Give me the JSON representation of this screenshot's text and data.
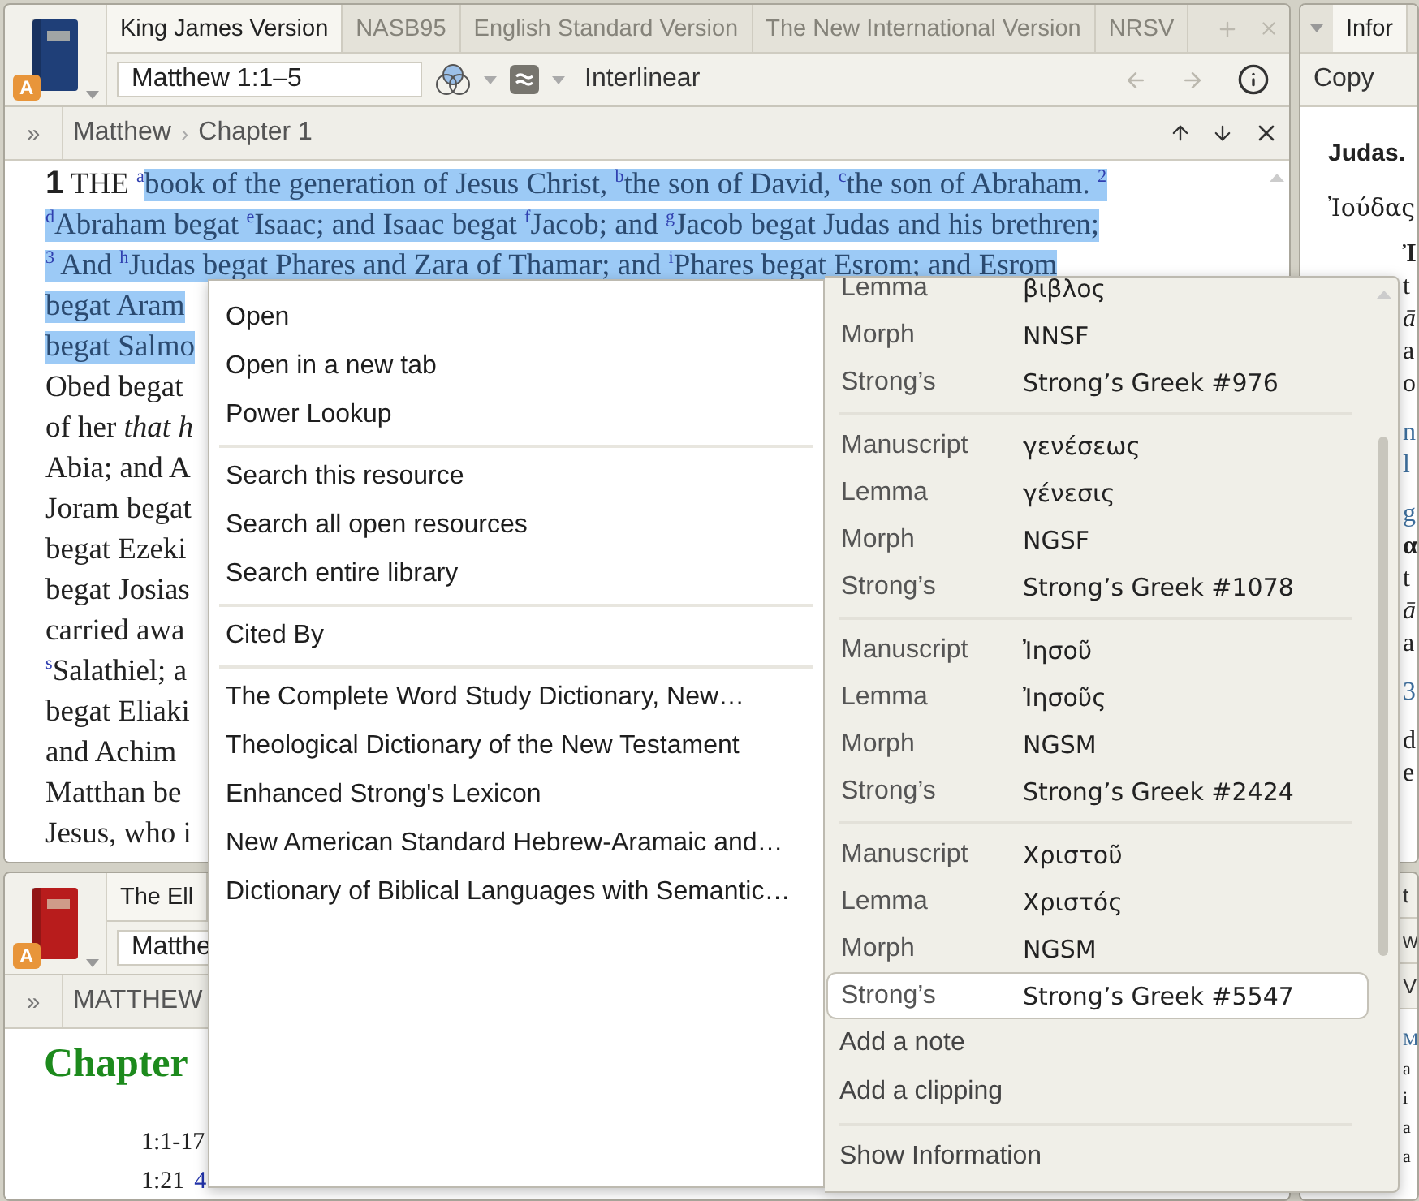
{
  "main_panel": {
    "badge": "A",
    "tabs": [
      {
        "label": "King James Version",
        "selected": true
      },
      {
        "label": "NASB95",
        "selected": false
      },
      {
        "label": "English Standard Version",
        "selected": false
      },
      {
        "label": "The New International Version",
        "selected": false
      },
      {
        "label": "NRSV",
        "selected": false
      }
    ],
    "reference": "Matthew 1:1–5",
    "view_label": "Interlinear",
    "back": {
      "disabled": true
    },
    "forward": {
      "disabled": true
    },
    "nav": {
      "expand": "»",
      "crumbs": [
        "Matthew",
        "Chapter 1"
      ],
      "separator": "›"
    },
    "lines": [
      {
        "segments": [
          {
            "text": "**1** THE $^{a}$",
            "selected": false
          },
          {
            "text": "book of the generation of Jesus Christ, $^{b}$the son of David, $^{c}$the son of Abraham. $^{2}$",
            "selected": true
          }
        ]
      },
      {
        "segments": [
          {
            "text": "$^{d}$Abraham begat $^{e}$Isaac; and Isaac begat $^{f}$Jacob; and $^{g}$Jacob begat Judas and his brethren;",
            "selected": true
          }
        ]
      },
      {
        "segments": [
          {
            "text": "$^{3}$ And $^{h}$Judas begat Phares and Zara of Thamar; and $^{i}$Phares begat Esrom; and Esrom",
            "selected": true
          }
        ]
      },
      {
        "segments": [
          {
            "text": "begat Aram",
            "selected": true
          }
        ]
      },
      {
        "segments": [
          {
            "text": "begat Salmo",
            "selected": true
          }
        ]
      },
      {
        "segments": [
          {
            "text": "Obed begat",
            "selected": false
          }
        ]
      },
      {
        "segments": [
          {
            "text": "of her *that h*",
            "selected": false
          }
        ]
      },
      {
        "segments": [
          {
            "text": "Abia; and A",
            "selected": false
          }
        ]
      },
      {
        "segments": [
          {
            "text": "Joram begat",
            "selected": false
          }
        ]
      },
      {
        "segments": [
          {
            "text": "begat Ezeki",
            "selected": false
          }
        ]
      },
      {
        "segments": [
          {
            "text": "begat Josias",
            "selected": false
          }
        ]
      },
      {
        "segments": [
          {
            "text": "carried awa",
            "selected": false
          }
        ]
      },
      {
        "segments": [
          {
            "text": "$^{s}$Salathiel; a",
            "selected": false
          }
        ]
      },
      {
        "segments": [
          {
            "text": "begat Eliaki",
            "selected": false
          }
        ]
      },
      {
        "segments": [
          {
            "text": "and Achim",
            "selected": false
          }
        ]
      },
      {
        "segments": [
          {
            "text": "Matthan be",
            "selected": false
          }
        ]
      },
      {
        "segments": [
          {
            "text": "Jesus, who i",
            "selected": false
          }
        ]
      }
    ]
  },
  "context_menu": {
    "groups": [
      [
        "Open",
        "Open in a new tab",
        "Power Lookup"
      ],
      [
        "Search this resource",
        "Search all open resources",
        "Search entire library"
      ],
      [
        "Cited By"
      ],
      [
        "The Complete Word Study Dictionary, New…",
        "Theological Dictionary of the New Testament",
        "Enhanced Strong's Lexicon",
        "New American Standard Hebrew-Aramaic and…",
        "Dictionary of Biblical Languages with Semantic…"
      ]
    ],
    "interlinear": [
      {
        "rows": [
          {
            "label": "Lemma",
            "value": "βιβλος",
            "selected": false
          },
          {
            "label": "Morph",
            "value": "NNSF",
            "selected": false
          },
          {
            "label": "Strong’s",
            "value": "Strong’s Greek #976",
            "selected": false
          }
        ]
      },
      {
        "rows": [
          {
            "label": "Manuscript",
            "value": "γενέσεως",
            "selected": false
          },
          {
            "label": "Lemma",
            "value": "γένεσις",
            "selected": false
          },
          {
            "label": "Morph",
            "value": "NGSF",
            "selected": false
          },
          {
            "label": "Strong’s",
            "value": "Strong’s Greek #1078",
            "selected": false
          }
        ]
      },
      {
        "rows": [
          {
            "label": "Manuscript",
            "value": "Ἰησοῦ",
            "selected": false
          },
          {
            "label": "Lemma",
            "value": "Ἰησοῦς",
            "selected": false
          },
          {
            "label": "Morph",
            "value": "NGSM",
            "selected": false
          },
          {
            "label": "Strong’s",
            "value": "Strong’s Greek #2424",
            "selected": false
          }
        ]
      },
      {
        "rows": [
          {
            "label": "Manuscript",
            "value": "Χριστοῦ",
            "selected": false
          },
          {
            "label": "Lemma",
            "value": "Χριστός",
            "selected": false
          },
          {
            "label": "Morph",
            "value": "NGSM",
            "selected": false
          },
          {
            "label": "Strong’s",
            "value": "Strong’s Greek #5547",
            "selected": true
          }
        ]
      }
    ],
    "actions": [
      [
        "Add a note",
        "Add a clipping"
      ],
      [
        "Show Information"
      ]
    ]
  },
  "lower_panel": {
    "badge": "A",
    "tabs": [
      {
        "label": "The Ell",
        "selected": true
      }
    ],
    "reference": "Matthe",
    "nav": {
      "expand": "»",
      "crumbs": [
        "MATTHEW"
      ]
    },
    "heading": "Chapter",
    "outline": [
      {
        "ref": "1:1-17"
      },
      {
        "ref": "1:21",
        "link": "4"
      }
    ]
  },
  "info_panel": {
    "tab": "Infor",
    "copy": "Copy",
    "title": "Judas.",
    "word": "Ἰούδας",
    "paragraphs": [
      {
        "lines": [
          {
            "text": "Ἰ",
            "kind": "bold"
          },
          {
            "text": "t",
            "kind": "plain"
          },
          {
            "text": "ā",
            "kind": "italic"
          },
          {
            "text": "a",
            "kind": "plain"
          },
          {
            "text": "o",
            "kind": "plain"
          }
        ]
      },
      {
        "lines": [
          {
            "text": "n",
            "kind": "link"
          },
          {
            "text": "l",
            "kind": "link"
          }
        ]
      },
      {
        "lines": [
          {
            "text": "g",
            "kind": "link"
          },
          {
            "text": "α",
            "kind": "bold"
          },
          {
            "text": "t",
            "kind": "plain"
          },
          {
            "text": "ā",
            "kind": "italic"
          },
          {
            "text": "a",
            "kind": "plain"
          }
        ]
      },
      {
        "lines": [
          {
            "text": "3",
            "kind": "link"
          }
        ]
      },
      {
        "lines": [
          {
            "text": "d",
            "kind": "plain"
          },
          {
            "text": "e",
            "kind": "plain"
          }
        ]
      }
    ]
  },
  "lower_right_panel": {
    "tab": "t",
    "field": "w",
    "nav": "V",
    "lines": [
      {
        "text": "M",
        "kind": "link"
      },
      {
        "text": "a",
        "kind": "plain"
      },
      {
        "text": "i",
        "kind": "plain"
      },
      {
        "text": "a",
        "kind": "plain"
      },
      {
        "text": "a",
        "kind": "plain"
      }
    ]
  }
}
